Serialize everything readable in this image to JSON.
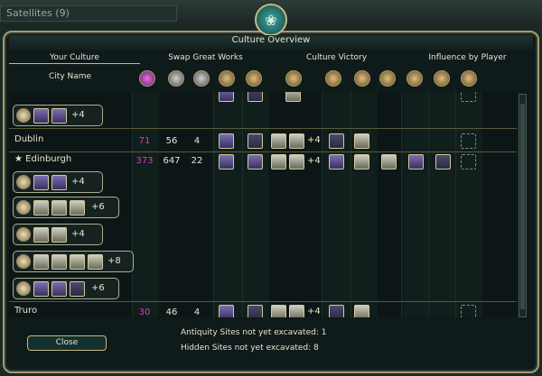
{
  "top": {
    "satellites": "Satellites (9)"
  },
  "title": "Culture Overview",
  "tabs": [
    "Your Culture",
    "Swap Great Works",
    "Culture Victory",
    "Influence by Player"
  ],
  "header": {
    "city_name": "City Name"
  },
  "rows": [
    {
      "city": "Dublin",
      "tourism": "71",
      "culture": "56",
      "gw": "4",
      "plus": "+4"
    },
    {
      "city": "Edinburgh",
      "tourism": "373",
      "culture": "647",
      "gw": "22",
      "plus": "+4"
    },
    {
      "city": "Truro",
      "tourism": "30",
      "culture": "46",
      "gw": "4",
      "plus": "+4"
    }
  ],
  "buildings": [
    {
      "plus": "+4"
    },
    {
      "plus": "+4"
    },
    {
      "plus": "+6"
    },
    {
      "plus": "+4"
    },
    {
      "plus": "+8"
    },
    {
      "plus": "+6"
    }
  ],
  "footer": {
    "antiquity": "Antiquity Sites not yet excavated: 1",
    "hidden": "Hidden Sites not yet excavated: 8",
    "close": "Close"
  }
}
